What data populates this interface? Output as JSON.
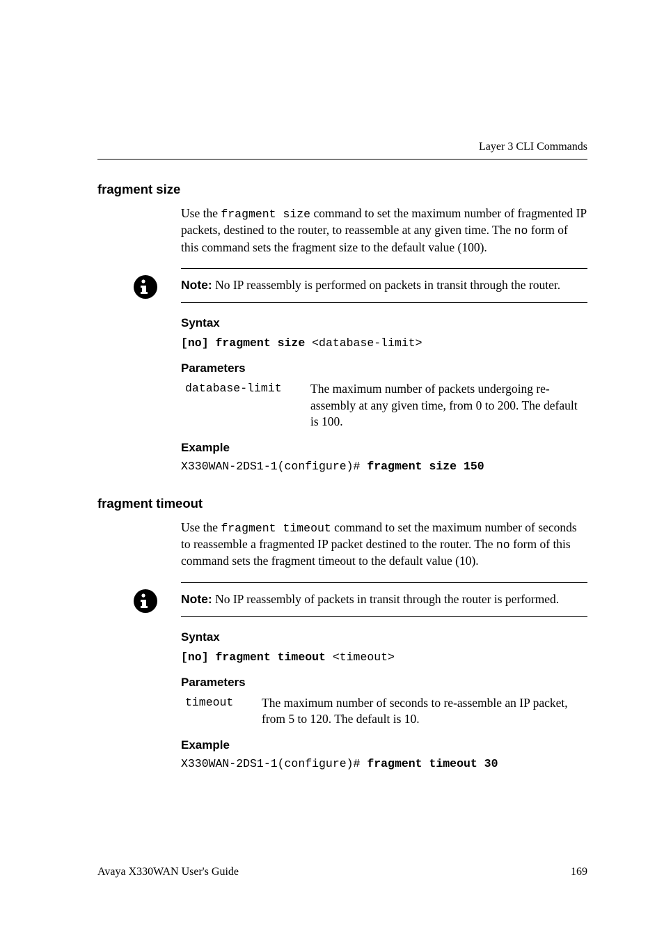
{
  "runningHeader": "Layer 3 CLI Commands",
  "section1": {
    "heading": "fragment size",
    "intro_pre": "Use the ",
    "intro_cmd": "fragment size",
    "intro_mid": " command to set the maximum number of fragmented IP packets, destined to the router, to reassemble at any given time. The ",
    "intro_no": "no",
    "intro_post": " form of this command sets the fragment size to the default value (100).",
    "note_label": "Note:",
    "note_text": "  No IP reassembly is performed on packets in transit through the router.",
    "syntax_heading": "Syntax",
    "syntax_bold": "[no] fragment size ",
    "syntax_arg": "<database-limit>",
    "params_heading": "Parameters",
    "param_name": "database-limit",
    "param_desc": "The maximum number of packets undergoing re-assembly at any given time, from 0 to 200. The default is 100.",
    "example_heading": "Example",
    "example_pre": "X330WAN-2DS1-1(configure)# ",
    "example_bold": "fragment size 150"
  },
  "section2": {
    "heading": "fragment timeout",
    "intro_pre": "Use the ",
    "intro_cmd": "fragment timeout",
    "intro_mid": " command to set the maximum number of seconds to reassemble a fragmented IP packet destined to the router. The ",
    "intro_no": "no",
    "intro_post": " form of this command sets the fragment timeout to the default value (10).",
    "note_label": "Note:",
    "note_text": "  No IP reassembly of packets in transit through the router is performed.",
    "syntax_heading": "Syntax",
    "syntax_bold": "[no] fragment timeout ",
    "syntax_arg": "<timeout>",
    "params_heading": "Parameters",
    "param_name": "timeout",
    "param_desc": "The maximum number of seconds to re-assemble an IP packet, from 5 to 120. The default is 10.",
    "example_heading": "Example",
    "example_pre": "X330WAN-2DS1-1(configure)# ",
    "example_bold": "fragment timeout 30"
  },
  "footer": {
    "left": "Avaya X330WAN User's Guide",
    "right": "169"
  }
}
